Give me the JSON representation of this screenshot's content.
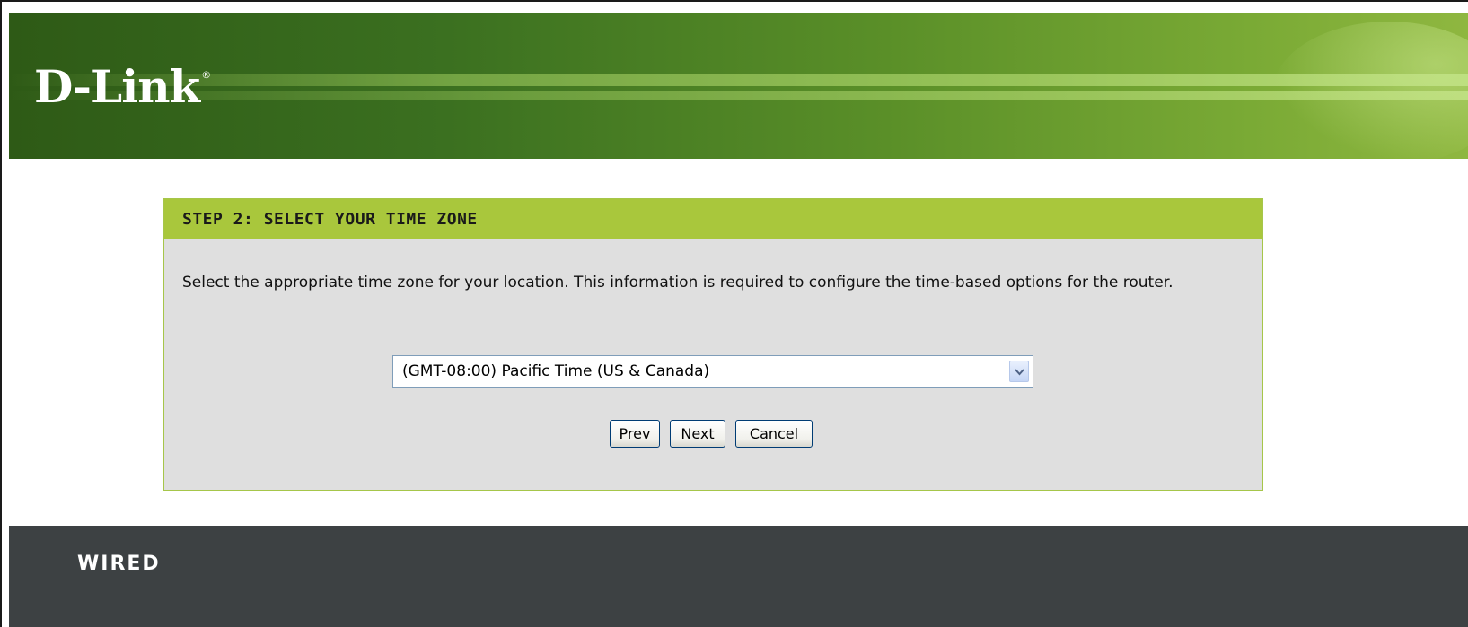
{
  "brand": {
    "logo_text": "D-Link",
    "registered_mark": "®"
  },
  "wizard": {
    "step_title": "STEP 2: SELECT YOUR TIME ZONE",
    "description": "Select the appropriate time zone for your location. This information is required to configure the time-based options for the router.",
    "timezone": {
      "selected": "(GMT-08:00) Pacific Time (US & Canada)",
      "dropdown_icon": "chevron-down-icon"
    },
    "buttons": {
      "prev": "Prev",
      "next": "Next",
      "cancel": "Cancel"
    }
  },
  "footer": {
    "label": "WIRED"
  },
  "colors": {
    "header_green": "#3b7020",
    "panel_title_green": "#a9c73c",
    "panel_background": "#dfdfdf",
    "footer_background": "#3d4143"
  }
}
